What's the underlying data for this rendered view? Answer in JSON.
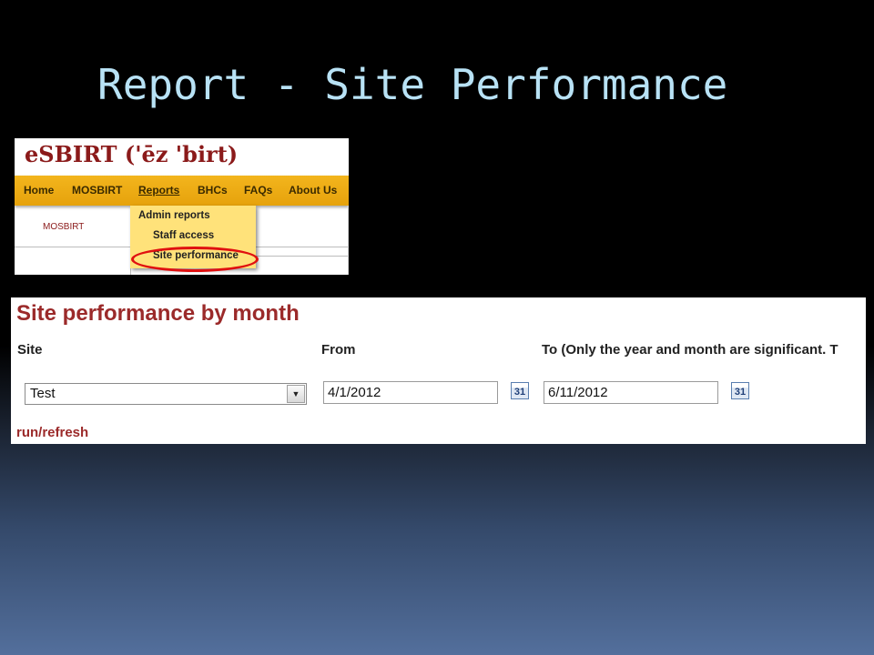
{
  "slide": {
    "title": "Report - Site Performance"
  },
  "site": {
    "logo": "eSBIRT ('ēz 'birt)",
    "nav": [
      {
        "label": "Home"
      },
      {
        "label": "MOSBIRT"
      },
      {
        "label": "Reports",
        "active": true
      },
      {
        "label": "BHCs"
      },
      {
        "label": "FAQs"
      },
      {
        "label": "About Us"
      }
    ],
    "breadcrumb": "MOSBIRT",
    "dropdown": [
      {
        "label": "Admin reports"
      },
      {
        "label": "Staff access"
      },
      {
        "label": "Site performance",
        "highlighted": true
      }
    ]
  },
  "report": {
    "title": "Site performance by month",
    "site_label": "Site",
    "from_label": "From",
    "to_label": "To (Only the year and month are significant. T",
    "site_value": "Test",
    "from_value": "4/1/2012",
    "to_value": "6/11/2012",
    "calendar_icon_text": "31",
    "run_label": "run/refresh"
  },
  "colors": {
    "title": "#b8e2f5",
    "brand": "#8b1a1a",
    "nav_bar": "#f3b51d",
    "dropdown": "#ffe27a",
    "highlight": "#e01010",
    "report_title": "#9b2a2a"
  }
}
